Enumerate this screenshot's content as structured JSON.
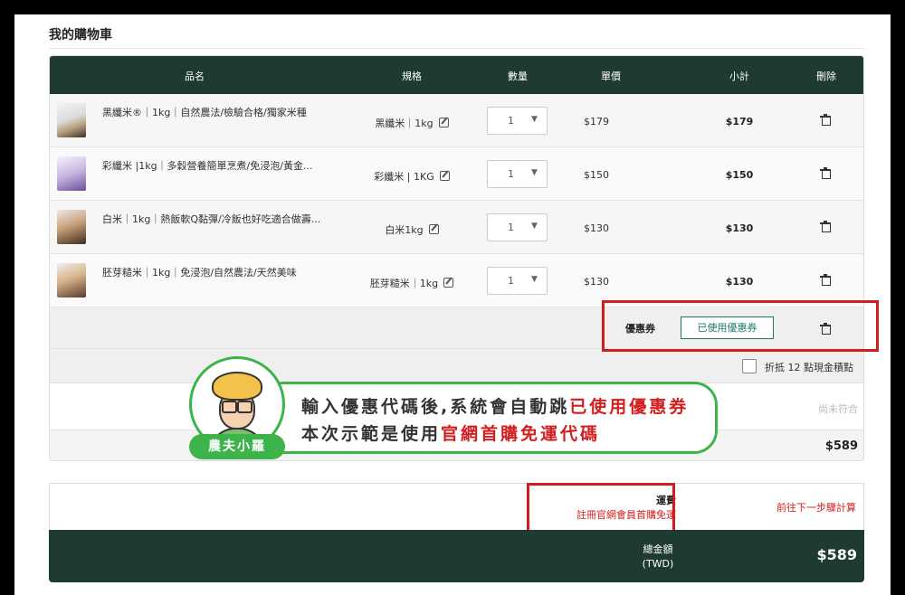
{
  "cart": {
    "title": "我的購物車",
    "columns": {
      "name": "品名",
      "spec": "規格",
      "qty": "數量",
      "price": "單價",
      "subtotal": "小計",
      "delete": "刪除"
    },
    "items": [
      {
        "name": "黑纖米®｜1kg｜自然農法/檢驗合格/獨家米種",
        "spec": "黑纖米｜1kg",
        "qty": "1",
        "price": "$179",
        "subtotal": "$179"
      },
      {
        "name": "彩纖米 |1kg｜多穀營養簡單烹煮/免浸泡/黃金...",
        "spec": "彩纖米 | 1KG",
        "qty": "1",
        "price": "$150",
        "subtotal": "$150"
      },
      {
        "name": "白米｜1kg｜熱飯軟Q黏彈/冷飯也好吃適合做壽...",
        "spec": "白米1kg",
        "qty": "1",
        "price": "$130",
        "subtotal": "$130"
      },
      {
        "name": "胚芽糙米｜1kg｜免浸泡/自然農法/天然美味",
        "spec": "胚芽糙米｜1kg",
        "qty": "1",
        "price": "$130",
        "subtotal": "$130"
      }
    ],
    "coupon": {
      "label": "優惠券",
      "button": "已使用優惠券"
    },
    "points": {
      "label": "折抵 12 點現金積點"
    },
    "eligibility": "尚未符合",
    "total": "$589"
  },
  "shipping": {
    "title": "運費",
    "note": "註冊官網會員首購免運",
    "next": "前往下一步驟計算"
  },
  "grand_total": {
    "label_line1": "總金額",
    "label_line2": "(TWD)",
    "value": "$589"
  },
  "callout": {
    "line1_a": "輸入優惠代碼後,系統會自動跳",
    "line1_b": "已使用優惠券",
    "line2_a": "本次示範是使用",
    "line2_b": "官網首購免運代碼",
    "mascot_name": "農夫小羅"
  },
  "colors": {
    "header": "#1e3a32",
    "accent": "#1b7a6e",
    "highlight": "#d21e1e",
    "bubble": "#3db44a"
  },
  "icons": {
    "delete": "trash-icon",
    "edit": "edit-icon",
    "select": "chevron-down-icon"
  }
}
